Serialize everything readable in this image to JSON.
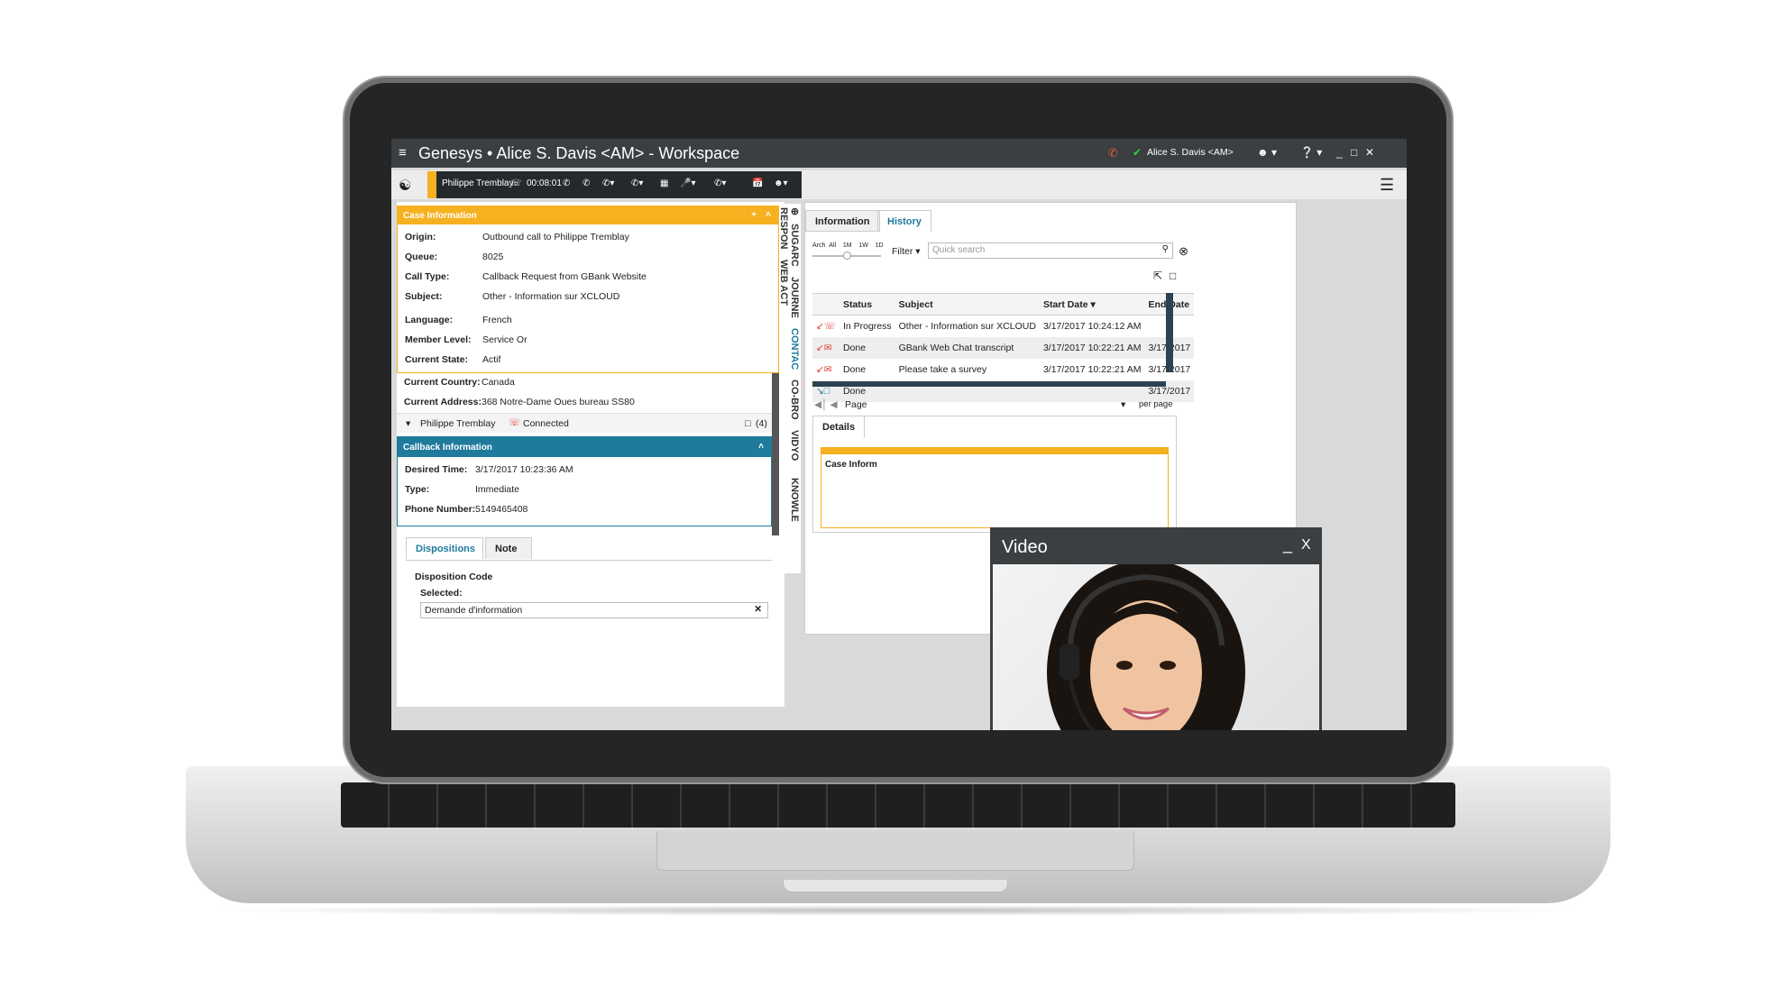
{
  "window": {
    "brand": "Genesys",
    "title": "Alice S. Davis <AM> - Workspace",
    "user_status": "Alice S. Davis <AM>"
  },
  "call": {
    "contact": "Philippe Tremblay",
    "timer": "00:08:01"
  },
  "case_info": {
    "header": "Case Information",
    "fields": [
      {
        "label": "Origin:",
        "value": "Outbound call to Philippe Tremblay"
      },
      {
        "label": "Queue:",
        "value": "8025"
      },
      {
        "label": "Call Type:",
        "value": "Callback Request from GBank Website"
      },
      {
        "label": "Subject:",
        "value": "Other - Information sur XCLOUD"
      },
      {
        "label": "Language:",
        "value": "French"
      },
      {
        "label": "Member Level:",
        "value": "Service Or"
      },
      {
        "label": "Current State:",
        "value": "Actif"
      },
      {
        "label": "Current Country:",
        "value": "Canada"
      },
      {
        "label": "Current Address:",
        "value": "368 Notre-Dame Oues bureau SS80"
      }
    ]
  },
  "party": {
    "name": "Philippe Tremblay",
    "status": "Connected",
    "count": "(4)"
  },
  "callback_info": {
    "header": "Callback Information",
    "fields": [
      {
        "label": "Desired Time:",
        "value": "3/17/2017 10:23:36 AM"
      },
      {
        "label": "Type:",
        "value": "Immediate"
      },
      {
        "label": "Phone Number:",
        "value": "5149465408"
      }
    ]
  },
  "disposition": {
    "tabs": [
      "Dispositions",
      "Note"
    ],
    "code_label": "Disposition Code",
    "selected_label": "Selected:",
    "selected_value": "Demande d'information"
  },
  "side_tabs": [
    "SUGARC",
    "JOURNE",
    "CONTAC",
    "CO-BRO",
    "VIDYO",
    "KNOWLE",
    "RESPON",
    "WEB ACT"
  ],
  "right": {
    "tabs": [
      "Information",
      "History"
    ],
    "range": [
      "Arch",
      "All",
      "1M",
      "1W",
      "1D"
    ],
    "filter_label": "Filter",
    "search_placeholder": "Quick search",
    "columns": [
      "Status",
      "Subject",
      "Start Date",
      "End Date"
    ],
    "rows": [
      {
        "status": "In Progress",
        "subject": "Other - Information sur XCLOUD",
        "start": "3/17/2017 10:24:12 AM",
        "end": ""
      },
      {
        "status": "Done",
        "subject": "GBank Web Chat transcript",
        "start": "3/17/2017 10:22:21 AM",
        "end": "3/17/2017"
      },
      {
        "status": "Done",
        "subject": "Please take a survey",
        "start": "3/17/2017 10:22:21 AM",
        "end": "3/17/2017"
      },
      {
        "status": "Done",
        "subject": "",
        "start": "",
        "end": "3/17/2017"
      }
    ],
    "page_label": "Page",
    "per_page_label": "per page",
    "details_tab": "Details",
    "case_info_short": "Case Inform"
  },
  "video": {
    "title": "Video",
    "min": "_",
    "close": "X"
  }
}
